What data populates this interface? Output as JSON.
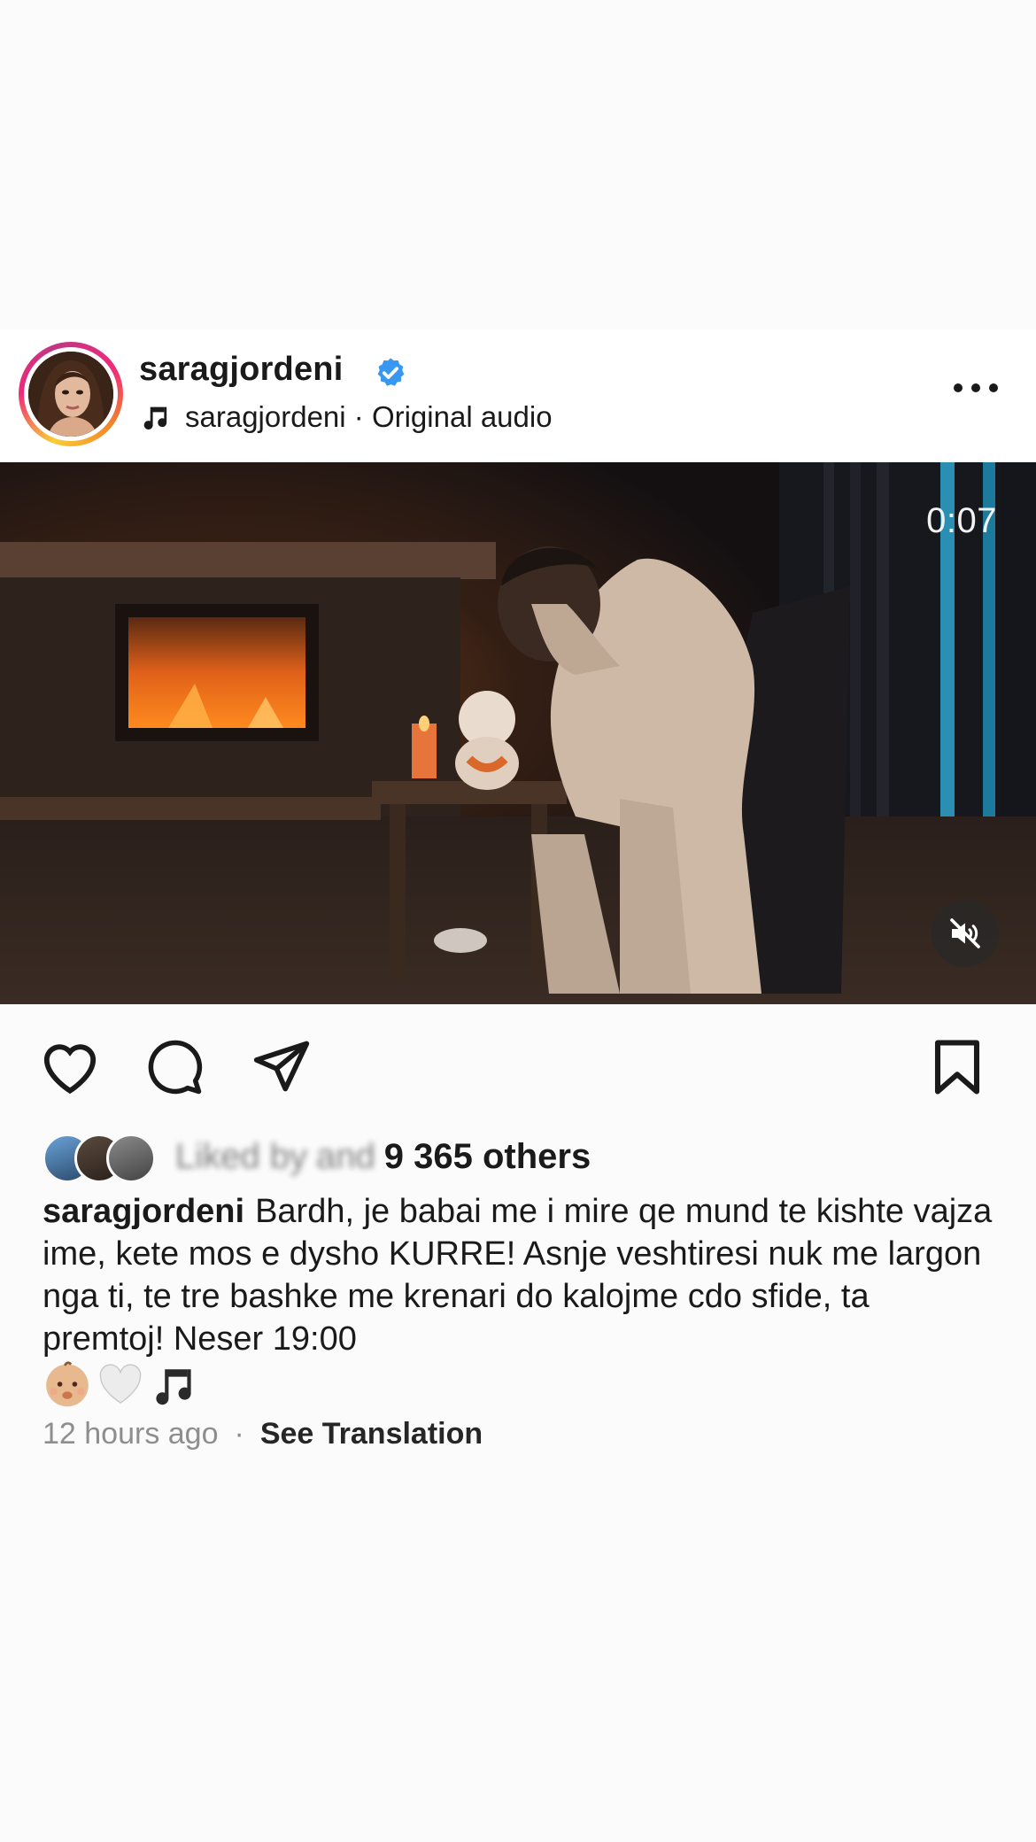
{
  "post": {
    "username": "saragjordeni",
    "audio": "saragjordeni · Original audio",
    "video_time": "0:07",
    "likes_obscured": "Liked by",
    "likes_count": "9 365 others",
    "likes_joiner": "and",
    "caption_user": "saragjordeni",
    "caption_text": "Bardh, je babai me i mire qe mund te kishte vajza ime, kete mos e dysho KURRE! Asnje veshtiresi nuk me largon nga ti, te tre bashke me krenari do kalojme cdo sfide, ta premtoj! Neser 19:00",
    "caption_emojis": [
      "baby-emoji",
      "white-heart-emoji",
      "music-note-emoji"
    ],
    "timestamp": "12 hours ago",
    "separator": "·",
    "see_translation": "See Translation"
  },
  "icons": {
    "verified": "verified-badge-icon",
    "audio": "music-note-icon",
    "more": "more-options-icon",
    "mute": "muted-speaker-icon",
    "like": "heart-icon",
    "comment": "comment-icon",
    "share": "send-icon",
    "save": "bookmark-icon"
  },
  "colors": {
    "verified_blue": "#3897f0",
    "text_primary": "#1a1a1a",
    "text_secondary": "#8e8e8e",
    "background": "#fbfbfb"
  }
}
